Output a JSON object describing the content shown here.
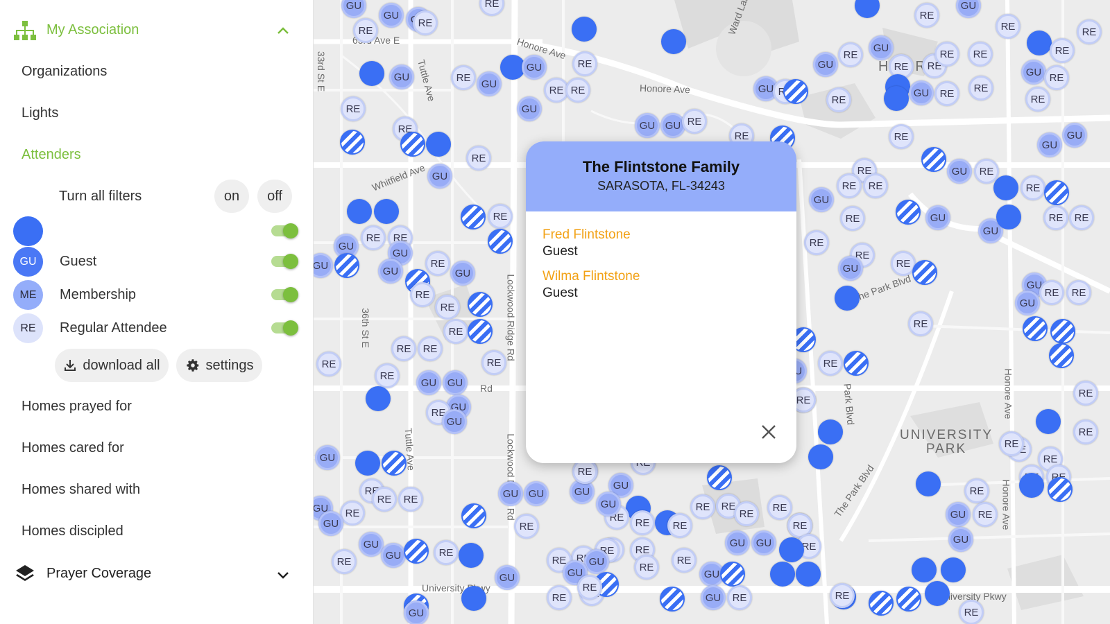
{
  "sidebar": {
    "association": {
      "label": "My Association",
      "icon": "org-chart-icon",
      "chevron": "chevron-up-icon"
    },
    "nav_items": [
      {
        "label": "Organizations"
      },
      {
        "label": "Lights"
      },
      {
        "label": "Attenders",
        "active": true
      }
    ],
    "filters": {
      "turn_all_label": "Turn all filters",
      "on_label": "on",
      "off_label": "off",
      "rows": [
        {
          "badge": "",
          "label": "",
          "color": "#3a6ff4",
          "enabled": true
        },
        {
          "badge": "GU",
          "label": "Guest",
          "color": "#4a78f5",
          "enabled": true
        },
        {
          "badge": "ME",
          "label": "Membership",
          "color": "#94adfa",
          "enabled": true
        },
        {
          "badge": "RE",
          "label": "Regular Attendee",
          "color": "#dde3fb",
          "enabled": true
        }
      ],
      "download_label": "download all",
      "settings_label": "settings"
    },
    "more_items": [
      {
        "label": "Homes prayed for"
      },
      {
        "label": "Homes cared for"
      },
      {
        "label": "Homes shared with"
      },
      {
        "label": "Homes discipled"
      }
    ],
    "coverage": {
      "label": "Prayer Coverage",
      "icon": "layers-icon",
      "chevron": "chevron-down-icon"
    }
  },
  "map": {
    "streets": [
      "63rd Ave E",
      "Honore Ave",
      "Honore Ave",
      "33rd St E",
      "Tuttle Ave",
      "Whitfield Ave",
      "36th St E",
      "Lockwood Ridge Rd",
      "Lockwood Ridge Rd",
      "Tuttle Ave",
      "University Pkwy",
      "Ward Lake",
      "Park Blvd",
      "The Park Blvd",
      "The Park Blvd",
      "Honore Ave",
      "University Pkwy",
      "Honore Ave",
      "Rd",
      "Hoen R"
    ],
    "area_label": "UNIVERSITY PARK",
    "colors": {
      "solid": "#3a6ff4",
      "guest": "#98acf6",
      "regular": "#dfe4fb",
      "accent": "#7cbf3e",
      "link": "#f2a114"
    }
  },
  "popup": {
    "title": "The Flintstone Family",
    "subtitle": "SARASOTA, FL-34243",
    "people": [
      {
        "name": "Fred Flintstone",
        "role": "Guest"
      },
      {
        "name": "Wilma Flintstone",
        "role": "Guest"
      }
    ]
  }
}
